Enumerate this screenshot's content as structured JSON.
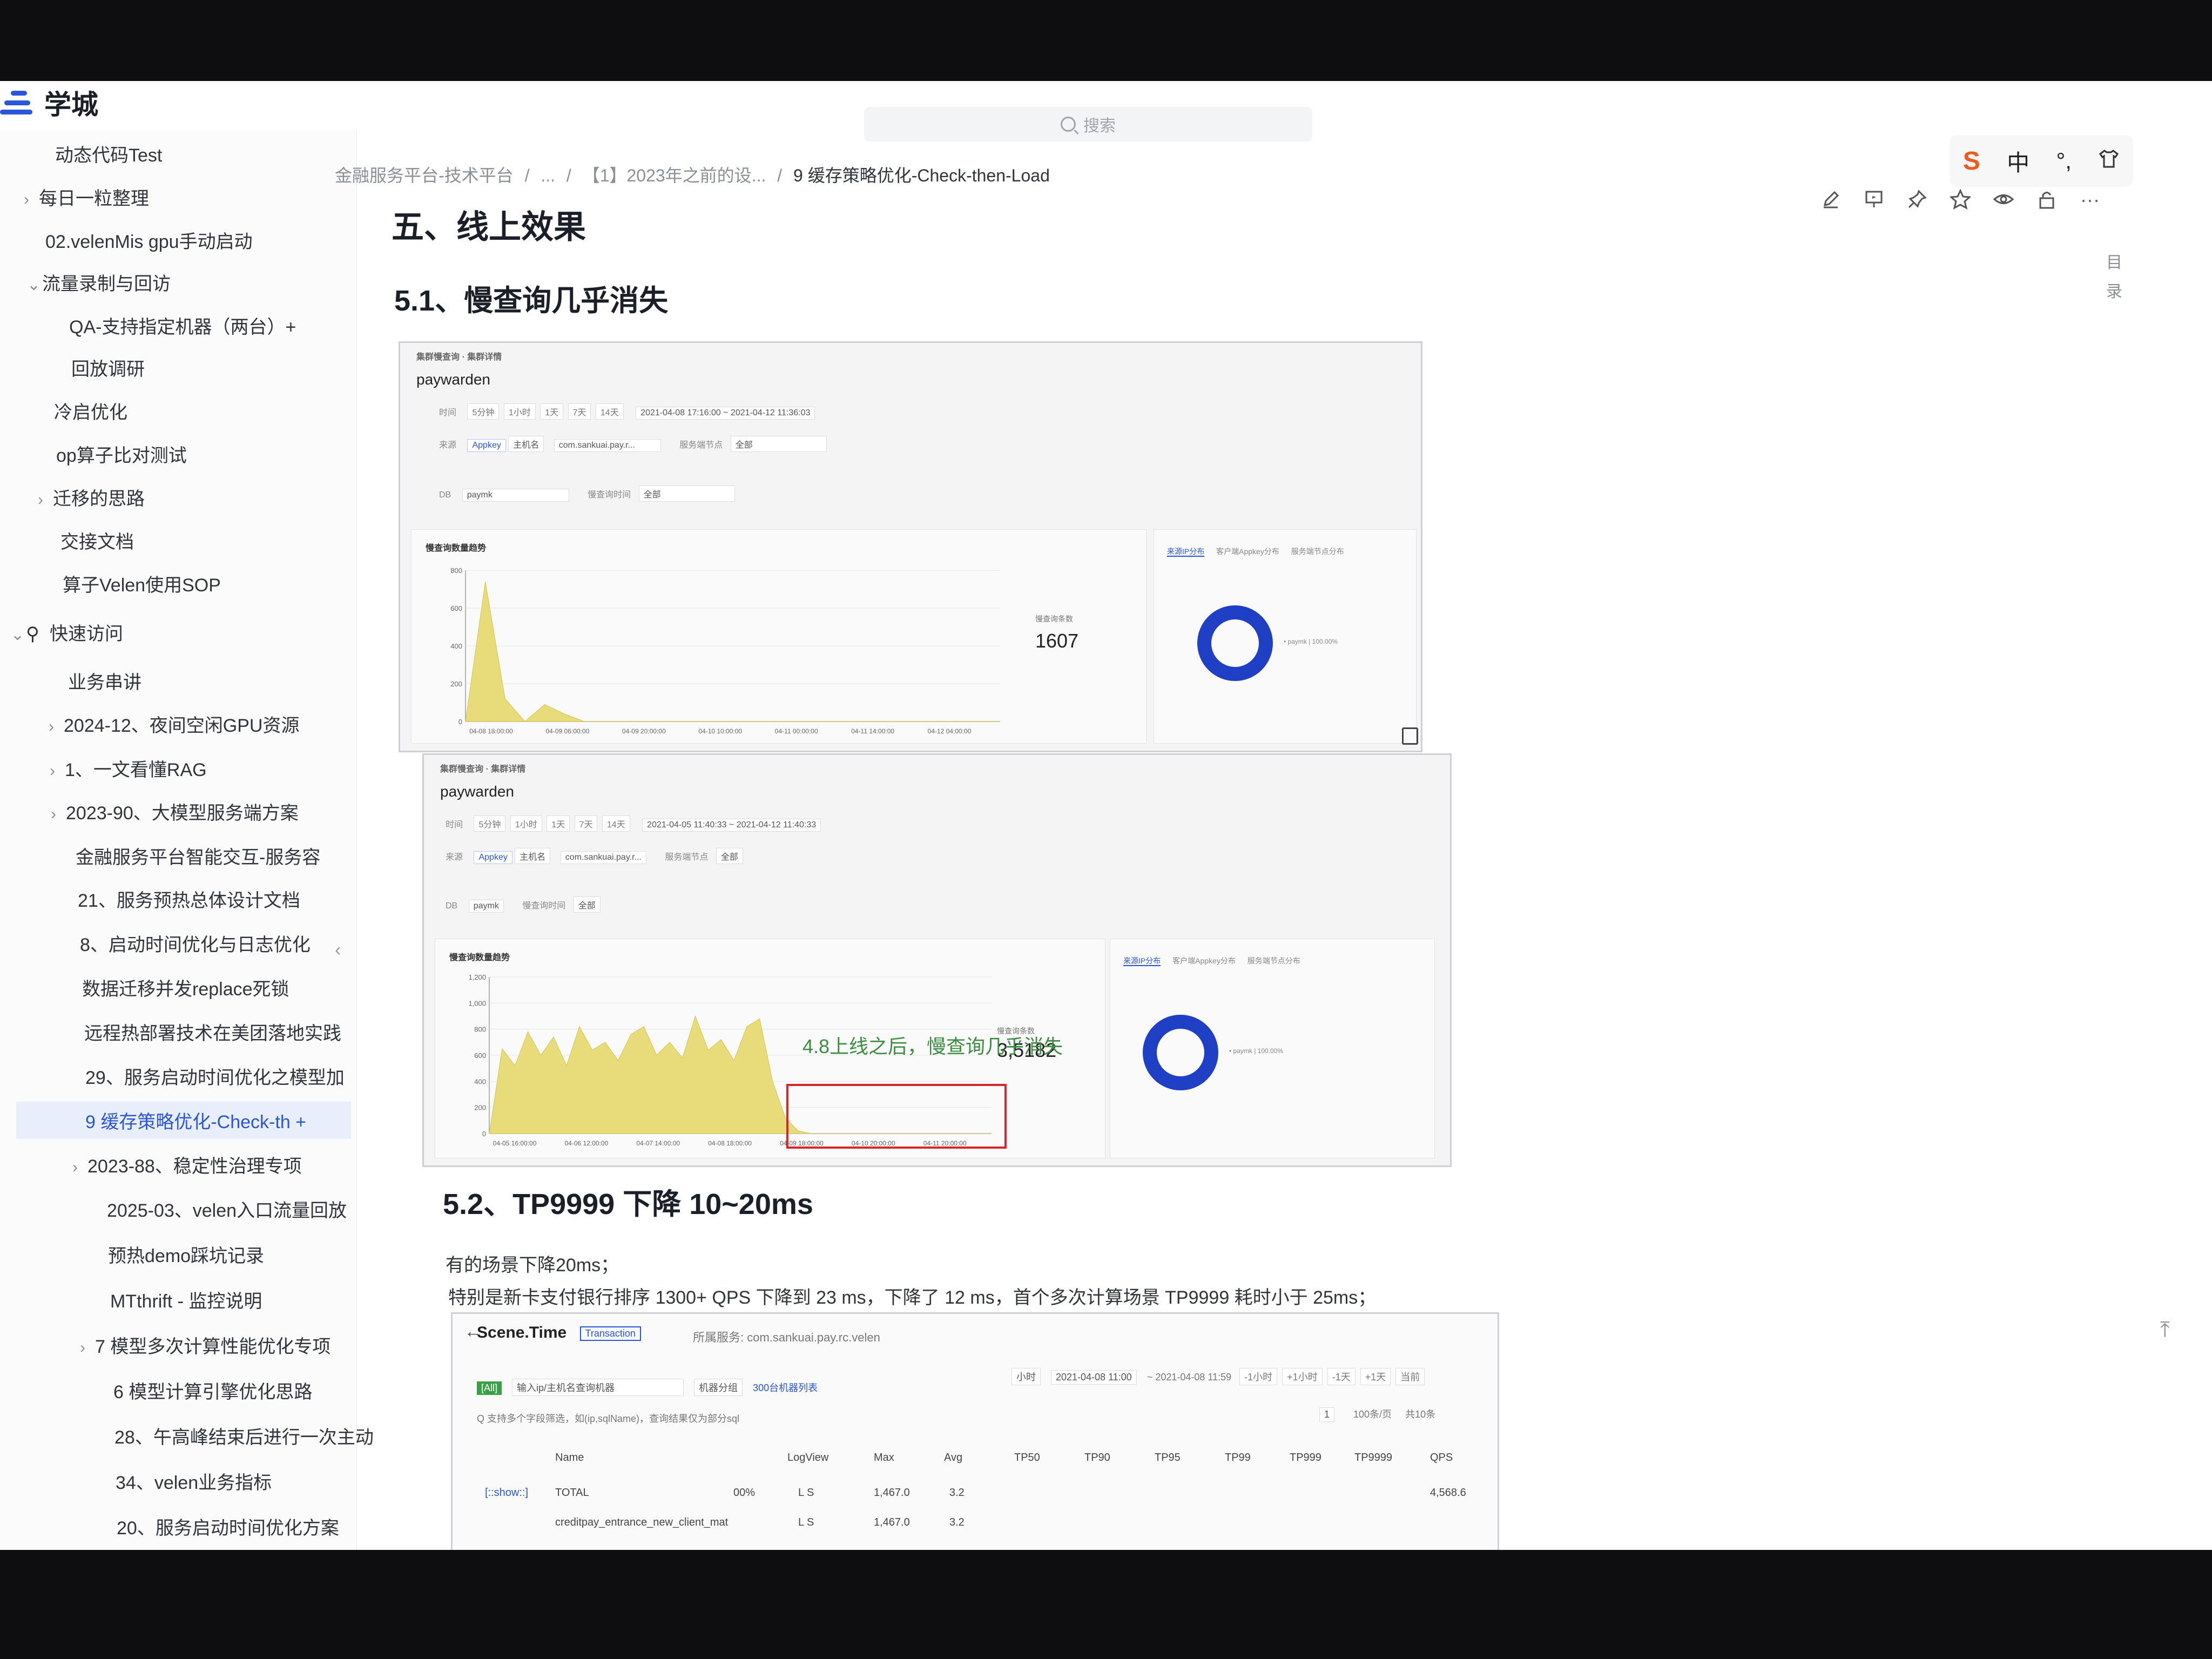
{
  "app": {
    "name": "学城",
    "search_placeholder": "搜索",
    "brand_color": "#2a56d9"
  },
  "ime": {
    "logo": "S",
    "mode": "中",
    "punct": "°,",
    "skin": "shirt-icon"
  },
  "toolbar": {
    "icons": [
      "edit-icon",
      "present-icon",
      "pin-icon",
      "star-icon",
      "eye-icon",
      "lock-icon",
      "more-icon"
    ],
    "more": "···"
  },
  "sidebar": {
    "items": [
      {
        "label": "动态代码Test",
        "chevron": ""
      },
      {
        "label": "每日一粒整理",
        "chevron": "›"
      },
      {
        "label": "02.velenMis gpu手动启动",
        "chevron": ""
      },
      {
        "label": "流量录制与回访",
        "chevron": "⌄"
      },
      {
        "label": "QA-支持指定机器（两台）+",
        "chevron": ""
      },
      {
        "label": "回放调研",
        "chevron": ""
      },
      {
        "label": "冷启优化",
        "chevron": ""
      },
      {
        "label": "op算子比对测试",
        "chevron": ""
      },
      {
        "label": "迁移的思路",
        "chevron": "›"
      },
      {
        "label": "交接文档",
        "chevron": ""
      },
      {
        "label": "算子Velen使用SOP",
        "chevron": ""
      },
      {
        "label": "快速访问",
        "chevron": "⌄"
      },
      {
        "label": "业务串讲",
        "chevron": ""
      },
      {
        "label": "2024-12、夜间空闲GPU资源",
        "chevron": "›"
      },
      {
        "label": "1、一文看懂RAG",
        "chevron": "›"
      },
      {
        "label": "2023-90、大模型服务端方案",
        "chevron": "›"
      },
      {
        "label": "金融服务平台智能交互-服务容",
        "chevron": ""
      },
      {
        "label": "21、服务预热总体设计文档",
        "chevron": ""
      },
      {
        "label": "8、启动时间优化与日志优化",
        "chevron": ""
      },
      {
        "label": "数据迁移并发replace死锁",
        "chevron": ""
      },
      {
        "label": "远程热部署技术在美团落地实践",
        "chevron": ""
      },
      {
        "label": "29、服务启动时间优化之模型加",
        "chevron": ""
      },
      {
        "label": "9 缓存策略优化-Check-th +",
        "chevron": ""
      },
      {
        "label": "2023-88、稳定性治理专项",
        "chevron": "›"
      },
      {
        "label": "2025-03、velen入口流量回放",
        "chevron": ""
      },
      {
        "label": "预热demo踩坑记录",
        "chevron": ""
      },
      {
        "label": "MTthrift - 监控说明",
        "chevron": ""
      },
      {
        "label": "7 模型多次计算性能优化专项",
        "chevron": "›"
      },
      {
        "label": "6 模型计算引擎优化思路",
        "chevron": ""
      },
      {
        "label": "28、午高峰结束后进行一次主动",
        "chevron": ""
      },
      {
        "label": "34、velen业务指标",
        "chevron": ""
      },
      {
        "label": "20、服务启动时间优化方案",
        "chevron": ""
      }
    ],
    "collapse": "‹",
    "pin_icon": "pin-icon"
  },
  "doc": {
    "breadcrumb": [
      "金融服务平台-技术平台",
      "...",
      "【1】2023年之前的设...",
      "9 缓存策略优化-Check-then-Load"
    ],
    "breadcrumb_sep": "/",
    "h1": "五、线上效果",
    "h2_1": "5.1、慢查询几乎消失",
    "h2_2": "5.2、TP9999 下降 10~20ms",
    "p1": "有的场景下降20ms；",
    "p2": "特别是新卡支付银行排序 1300+ QPS 下降到 23 ms，下降了 12 ms，首个多次计算场景 TP9999 耗时小于 25ms；",
    "toc": "目录",
    "to_top": "⤒"
  },
  "shot1": {
    "tabs": "集群慢查询  ·  集群详情",
    "name": "paywarden",
    "time_label": "时间",
    "ranges": [
      "5分钟",
      "1小时",
      "1天",
      "7天",
      "14天"
    ],
    "time_range": "2021-04-08 17:16:00 ~ 2021-04-12 11:36:03",
    "source_label": "来源",
    "appkey_chip": "Appkey",
    "host_chip": "主机名",
    "appkey_value": "com.sankuai.pay.r...",
    "node_label": "服务端节点",
    "node_value": "全部",
    "db_label": "DB",
    "db_value": "paymk",
    "time_cost_label": "慢查询时间",
    "time_cost_value": "全部",
    "card_title": "慢查询数量趋势",
    "count_label": "慢查询条数",
    "count_value": "1607",
    "donut_tabs": [
      "来源IP分布",
      "客户端Appkey分布",
      "服务端节点分布"
    ],
    "donut_legend": "• paymk | 100.00%"
  },
  "shot2": {
    "tabs": "集群慢查询  ·  集群详情",
    "name": "paywarden",
    "time_label": "时间",
    "ranges": [
      "5分钟",
      "1小时",
      "1天",
      "7天",
      "14天"
    ],
    "time_range": "2021-04-05 11:40:33 ~ 2021-04-12 11:40:33",
    "source_label": "来源",
    "appkey_chip": "Appkey",
    "host_chip": "主机名",
    "appkey_value": "com.sankuai.pay.r...",
    "node_label": "服务端节点",
    "node_value": "全部",
    "db_label": "DB",
    "db_value": "paymk",
    "time_cost_label": "慢查询时间",
    "time_cost_value": "全部",
    "card_title": "慢查询数量趋势",
    "count_label": "慢查询条数",
    "count_value": "3,5182",
    "annotation": "4.8上线之后，慢查询几乎消失",
    "donut_tabs": [
      "来源IP分布",
      "客户端Appkey分布",
      "服务端节点分布"
    ],
    "donut_legend": "• paymk | 100.00%"
  },
  "chart_data": [
    {
      "type": "area",
      "title": "慢查询数量趋势",
      "x": [
        "04-08 18:00:00",
        "04-09 06:00:00",
        "04-09 20:00:00",
        "04-10 10:00:00",
        "04-11 00:00:00",
        "04-11 14:00:00",
        "04-12 04:00:00"
      ],
      "series": [
        {
          "values": [
            0,
            740,
            120,
            0,
            90,
            40,
            0,
            0,
            0,
            0,
            0,
            0,
            0,
            0,
            0,
            0,
            0,
            0,
            0,
            0,
            0,
            0,
            0,
            0,
            0,
            0,
            0,
            0
          ]
        }
      ],
      "ylim": [
        0,
        800
      ],
      "yticks": [
        0,
        200,
        400,
        600,
        800
      ],
      "color": "#e8dc7a"
    },
    {
      "type": "area",
      "title": "慢查询数量趋势",
      "x": [
        "04-05 16:00:00",
        "04-06 12:00:00",
        "04-07 14:00:00",
        "04-08 18:00:00",
        "04-09 18:00:00",
        "04-10 20:00:00",
        "04-11 20:00:00"
      ],
      "series": [
        {
          "values": [
            0,
            650,
            520,
            780,
            600,
            740,
            520,
            820,
            640,
            700,
            560,
            760,
            820,
            600,
            700,
            580,
            900,
            640,
            720,
            560,
            820,
            880,
            400,
            120,
            20,
            0,
            0,
            0,
            0,
            0,
            0,
            0,
            0,
            0,
            0,
            0,
            0,
            0,
            0,
            0
          ]
        }
      ],
      "ylim": [
        0,
        1200
      ],
      "yticks": [
        0,
        200,
        400,
        600,
        800,
        1000,
        1200
      ],
      "color": "#e8dc7a"
    }
  ],
  "table_shot": {
    "back": "←",
    "title": "Scene.Time",
    "tag": "Transaction",
    "service": "所属服务: com.sankuai.pay.rc.velen",
    "all": "[All]",
    "input_placeholder": "输入ip/主机名查询机器",
    "group": "机器分组",
    "machines": "300台机器列表",
    "unit": "小时",
    "start": "2021-04-08 11:00",
    "end": "~ 2021-04-08 11:59",
    "nav": [
      "-1小时",
      "+1小时",
      "-1天",
      "+1天",
      "当前"
    ],
    "page": "1",
    "per_page": "100条/页",
    "total": "共10条",
    "filter_hint": "Q 支持多个字段筛选，如(ip,sqlName)，查询结果仅为部分sql",
    "columns": [
      "Name",
      "LogView",
      "Max",
      "Avg",
      "TP50",
      "TP90",
      "TP95",
      "TP99",
      "TP999",
      "TP9999",
      "QPS"
    ],
    "rows": [
      {
        "prefix": "[::show::]",
        "name": "TOTAL",
        "pct": "00%",
        "logview": "L S",
        "max": "1,467.0",
        "avg": "3.2",
        "qps": "4,568.6"
      },
      {
        "prefix": "",
        "name": "creditpay_entrance_new_client_mat",
        "pct": "",
        "logview": "L S",
        "max": "1,467.0",
        "avg": "3.2",
        "qps": ""
      }
    ]
  }
}
